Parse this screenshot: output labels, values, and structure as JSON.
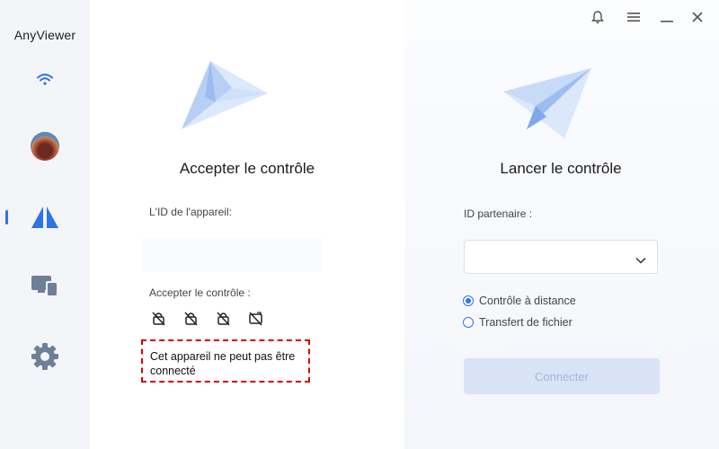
{
  "app": {
    "title": "AnyViewer"
  },
  "sidebar": {
    "items": [
      {
        "name": "connection-status",
        "icon": "wifi-icon"
      },
      {
        "name": "account",
        "icon": "avatar"
      },
      {
        "name": "remote-control",
        "icon": "anyviewer-logo-icon",
        "active": true
      },
      {
        "name": "devices",
        "icon": "devices-icon"
      },
      {
        "name": "settings",
        "icon": "gear-icon"
      }
    ]
  },
  "titlebar": {
    "icons": [
      "bell-icon",
      "menu-icon",
      "minimize-icon",
      "close-icon"
    ]
  },
  "left_panel": {
    "title": "Accepter le contrôle",
    "device_id_label": "L'ID de l'appareil:",
    "device_id_value": "",
    "accept_label": "Accepter le contrôle :",
    "status_icons": [
      "lock-off-icon",
      "lock-off-icon",
      "lock-off-icon",
      "screen-off-icon"
    ],
    "warning": "Cet appareil ne peut pas être connecté"
  },
  "right_panel": {
    "title": "Lancer le contrôle",
    "partner_label": "ID partenaire :",
    "partner_value": "",
    "options": [
      {
        "label": "Contrôle à distance",
        "selected": true
      },
      {
        "label": "Transfert de fichier",
        "selected": false
      }
    ],
    "connect_label": "Connecter"
  },
  "colors": {
    "accent": "#2d74e6",
    "warning_border": "#d40000",
    "disabled_button": "#d8e3f6",
    "sidebar_bg": "#f4f5f9"
  }
}
